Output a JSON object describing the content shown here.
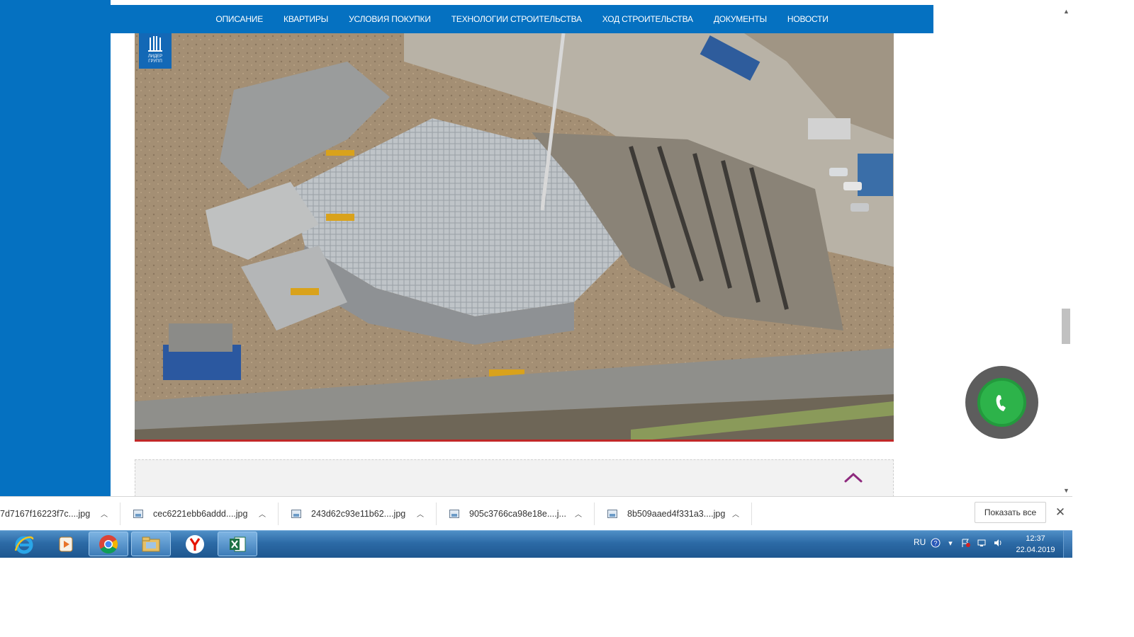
{
  "nav": {
    "items": [
      "ОПИСАНИЕ",
      "КВАРТИРЫ",
      "УСЛОВИЯ ПОКУПКИ",
      "ТЕХНОЛОГИИ СТРОИТЕЛЬСТВА",
      "ХОД СТРОИТЕЛЬСТВА",
      "ДОКУМЕНТЫ",
      "НОВОСТИ"
    ]
  },
  "logo": {
    "line1": "ЛИДЕР",
    "line2": "ГРУПП"
  },
  "colors": {
    "brand_blue": "#0571c1",
    "call_green": "#2db34a",
    "accent_purple": "#8e2a7e"
  },
  "downloads": {
    "files": [
      "7d7167f16223f7c....jpg",
      "cec6221ebb6addd....jpg",
      "243d62c93e11b62....jpg",
      "905c3766ca98e18e....j...",
      "8b509aaed4f331a3....jpg"
    ],
    "show_all": "Показать все"
  },
  "taskbar": {
    "apps": [
      "internet-explorer-icon",
      "media-player-icon",
      "chrome-icon",
      "file-explorer-icon",
      "yandex-browser-icon",
      "excel-icon"
    ],
    "lang": "RU",
    "time": "12:37",
    "date": "22.04.2019"
  }
}
